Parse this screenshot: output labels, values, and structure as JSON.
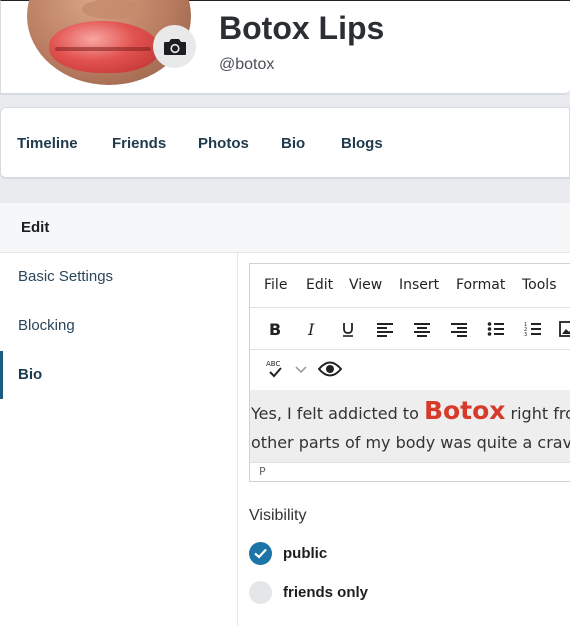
{
  "profile": {
    "name": "Botox Lips",
    "handle": "@botox"
  },
  "tabs": [
    "Timeline",
    "Friends",
    "Photos",
    "Bio",
    "Blogs"
  ],
  "panel": {
    "title": "Edit",
    "side_nav": [
      "Basic Settings",
      "Blocking",
      "Bio"
    ],
    "active_item": "Bio"
  },
  "editor": {
    "menu": [
      "File",
      "Edit",
      "View",
      "Insert",
      "Format",
      "Tools"
    ],
    "toolbar_icons": [
      "bold-icon",
      "italic-icon",
      "underline-icon",
      "align-left-icon",
      "align-center-icon",
      "align-right-icon",
      "bullet-list-icon",
      "numbered-list-icon",
      "image-icon"
    ],
    "toolbar2_icons": [
      "spellcheck-icon",
      "chevron-down-icon",
      "preview-eye-icon"
    ],
    "content": {
      "line1_start": "Yes, I felt addicted to ",
      "line1_highlight": "Botox",
      "line1_end": " right from the start",
      "line2": "other parts of my body was quite a craving"
    },
    "status_path": "P",
    "highlight_color": "#d63a2a"
  },
  "visibility": {
    "label": "Visibility",
    "options": [
      {
        "label": "public",
        "checked": true
      },
      {
        "label": "friends only",
        "checked": false
      }
    ],
    "accent_color": "#1d74a6"
  }
}
